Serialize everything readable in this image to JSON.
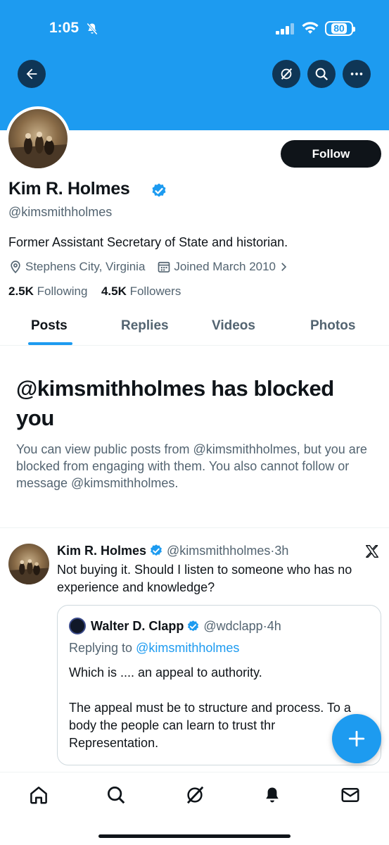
{
  "status_bar": {
    "time": "1:05",
    "battery": "80"
  },
  "profile": {
    "display_name": "Kim R. Holmes",
    "handle": "@kimsmithholmes",
    "bio": "Former Assistant Secretary of State and historian.",
    "location": "Stephens City, Virginia",
    "joined": "Joined March 2010",
    "following_count": "2.5K",
    "following_label": "Following",
    "followers_count": "4.5K",
    "followers_label": "Followers",
    "follow_button": "Follow"
  },
  "tabs": [
    {
      "label": "Posts",
      "active": true
    },
    {
      "label": "Replies",
      "active": false
    },
    {
      "label": "Videos",
      "active": false
    },
    {
      "label": "Photos",
      "active": false
    }
  ],
  "blocked": {
    "title": "@kimsmithholmes has blocked you",
    "body": "You can view public posts from @kimsmithholmes, but you are blocked from engaging with them. You also cannot follow or message @kimsmithholmes."
  },
  "post": {
    "author_name": "Kim R. Holmes",
    "author_handle": "@kimsmithholmes",
    "time": "3h",
    "text": "Not buying it. Should I listen to someone who has no experience and knowledge?",
    "quote": {
      "author_name": "Walter D. Clapp",
      "author_handle": "@wdclapp",
      "time": "4h",
      "replying_prefix": "Replying to",
      "replying_to": "@kimsmithholmes",
      "text": "Which is .... an appeal to authority.\n\nThe appeal must be to structure and process. To a body the people can learn to trust thr Representation."
    }
  },
  "icons": {
    "back": "back-arrow-icon",
    "grok": "grok-icon",
    "search": "search-icon",
    "more": "more-icon",
    "location": "location-pin-icon",
    "calendar": "calendar-icon",
    "verified": "verified-badge-icon",
    "x_logo": "x-logo-icon",
    "compose": "plus-icon",
    "nav": [
      "home-icon",
      "search-icon",
      "grok-icon",
      "notifications-icon",
      "messages-icon"
    ]
  },
  "colors": {
    "accent": "#1d9bf0",
    "text_primary": "#0f1419",
    "text_secondary": "#536471",
    "button_dark": "#0f1419"
  }
}
